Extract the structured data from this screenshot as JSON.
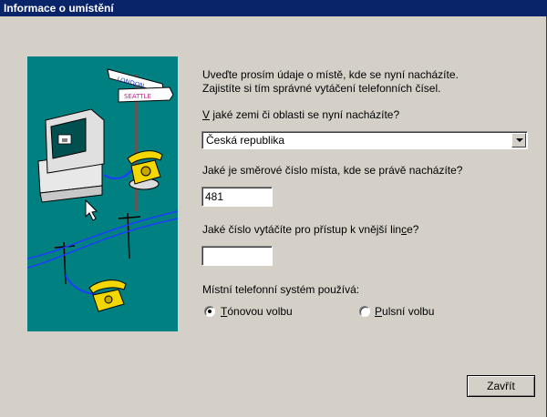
{
  "window": {
    "title": "Informace o umístění"
  },
  "intro": {
    "line1": "Uveďte prosím údaje o místě, kde se nyní nacházíte.",
    "line2": "Zajistíte si tím správné vytáčení telefonních čísel."
  },
  "country": {
    "label_accel": "V",
    "label_rest": " jaké zemi či oblasti se nyní nacházíte?",
    "selected": "Česká republika"
  },
  "area_code": {
    "label_pre": "Jaké je směrové číslo místa, kde se právě nacházíte?",
    "value": "481"
  },
  "outside_line": {
    "label_pre": "Jaké číslo vytáčíte pro přístup k vnější lin",
    "label_accel": "c",
    "label_post": "e?",
    "value": ""
  },
  "dialing": {
    "label": "Místní telefonní systém používá:",
    "tone_accel": "T",
    "tone_rest": "ónovou volbu",
    "pulse_accel": "P",
    "pulse_rest": "ulsní volbu",
    "selected": "tone"
  },
  "close_button": {
    "label": "Zavřít"
  },
  "illustration": {
    "sign_top": "LONDON",
    "sign_bottom": "SEATTLE"
  }
}
